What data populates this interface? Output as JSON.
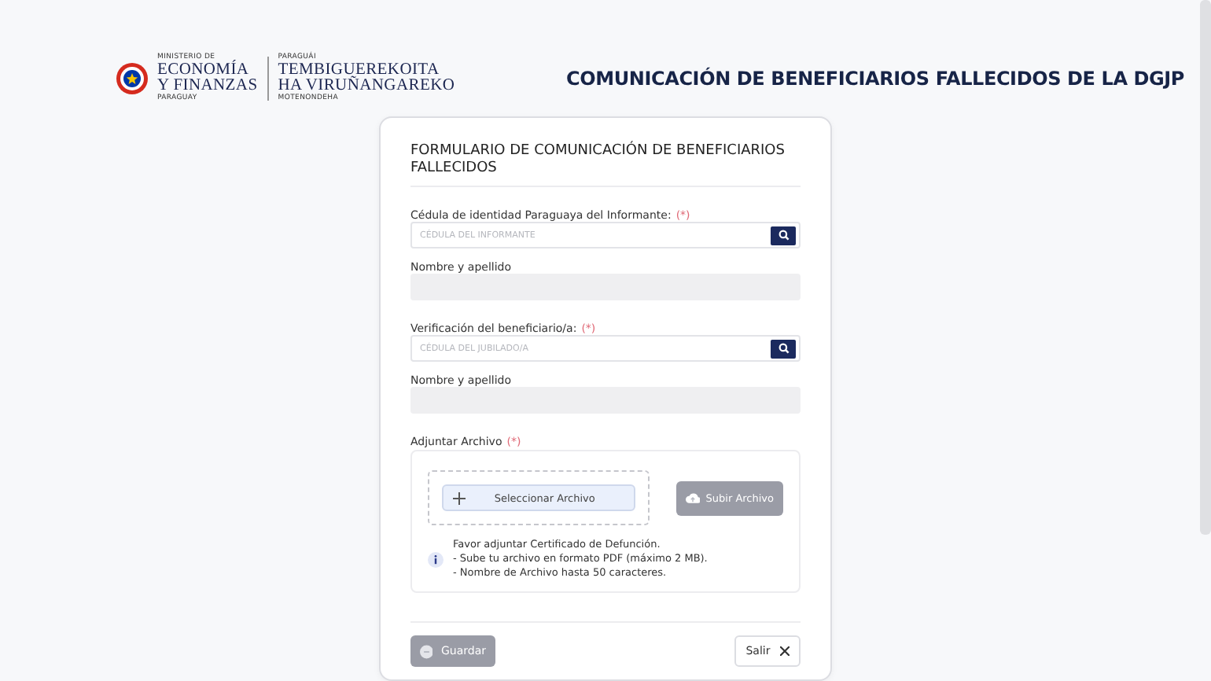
{
  "header": {
    "logo": {
      "left": [
        "MINISTERIO DE",
        "ECONOMÍA",
        "Y FINANZAS",
        "PARAGUAY"
      ],
      "right": [
        "PARAGUÁI",
        "TEMBIGUEREKOITA",
        "HA VIRUÑANGAREKO",
        "MOTENONDEHA"
      ]
    },
    "title": "COMUNICACIÓN DE BENEFICIARIOS FALLECIDOS DE LA DGJP"
  },
  "form": {
    "title": "FORMULARIO DE COMUNICACIÓN DE BENEFICIARIOS FALLECIDOS",
    "fields": [
      {
        "kind": "search",
        "label": "Cédula de identidad Paraguaya del Informante:",
        "required_mark": "(*)",
        "placeholder": "CÉDULA DEL INFORMANTE"
      },
      {
        "kind": "readonly",
        "label": "Nombre y apellido"
      },
      {
        "kind": "search",
        "label": "Verificación del beneficiario/a:",
        "required_mark": "(*)",
        "placeholder": "CÉDULA DEL JUBILADO/A"
      },
      {
        "kind": "readonly",
        "label": "Nombre y apellido"
      }
    ],
    "attachment": {
      "label": "Adjuntar Archivo",
      "required_mark": "(*)",
      "select_button": "Seleccionar Archivo",
      "upload_button": {
        "label": "Subir Archivo",
        "disabled": true
      },
      "info": [
        "Favor adjuntar Certificado de Defunción.",
        "- Sube tu archivo en formato PDF (máximo 2 MB).",
        "- Nombre de Archivo hasta 50 caracteres."
      ]
    },
    "buttons": {
      "save": {
        "label": "Guardar",
        "disabled": true
      },
      "exit": {
        "label": "Salir"
      }
    }
  }
}
